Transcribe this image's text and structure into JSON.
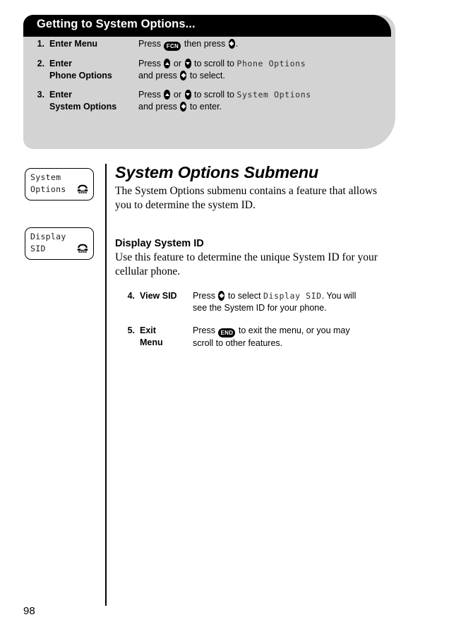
{
  "callout": {
    "title": "Getting to System Options...",
    "steps": [
      {
        "num": "1.",
        "title_line1": "Enter Menu",
        "title_line2": "",
        "body_pre": "Press ",
        "key1": "FCN",
        "body_mid": " then press ",
        "key2": "select",
        "body_post": ".",
        "line2": ""
      },
      {
        "num": "2.",
        "title_line1": "Enter",
        "title_line2": "Phone Options",
        "body_pre": "Press ",
        "key1": "up",
        "body_mid": " or ",
        "key2": "down",
        "body_post": " to scroll to ",
        "lcd": "Phone Options",
        "line2_pre": "and press ",
        "line2_key": "select",
        "line2_post": " to select."
      },
      {
        "num": "3.",
        "title_line1": "Enter",
        "title_line2": "System Options",
        "body_pre": "Press ",
        "key1": "up",
        "body_mid": " or ",
        "key2": "down",
        "body_post": " to scroll to ",
        "lcd": "System Options",
        "line2_pre": "and press ",
        "line2_key": "select",
        "line2_post": " to enter."
      }
    ]
  },
  "lcd_boxes": [
    {
      "line1": "System",
      "line2": "Options",
      "icon": "roam-phone-icon"
    },
    {
      "line1": "Display",
      "line2": "SID",
      "icon": "roam-phone-icon"
    }
  ],
  "main": {
    "heading": "System Options Submenu",
    "intro": "The System Options submenu contains a feature that allows you to determine the system ID.",
    "subheading": "Display System ID",
    "subtext": "Use this feature to determine the unique System ID for your cellular phone."
  },
  "lower_steps": [
    {
      "num": "4.",
      "title_line1": "View SID",
      "title_line2": "",
      "body_pre": "Press ",
      "key1": "select",
      "body_mid": " to select ",
      "lcd": "Display SID",
      "body_post": ". You will",
      "line2": "see the System ID for your phone."
    },
    {
      "num": "5.",
      "title_line1": "Exit",
      "title_line2": "Menu",
      "body_pre": "Press ",
      "key1": "END",
      "body_mid": " to exit the menu, or you may",
      "lcd": "",
      "body_post": "",
      "line2": "scroll to other features."
    }
  ],
  "footer": {
    "page_number": "98"
  },
  "colors": {
    "header_bg": "#000000",
    "panel_bg": "#d3d3d3",
    "text": "#000000",
    "header_text": "#ffffff"
  }
}
